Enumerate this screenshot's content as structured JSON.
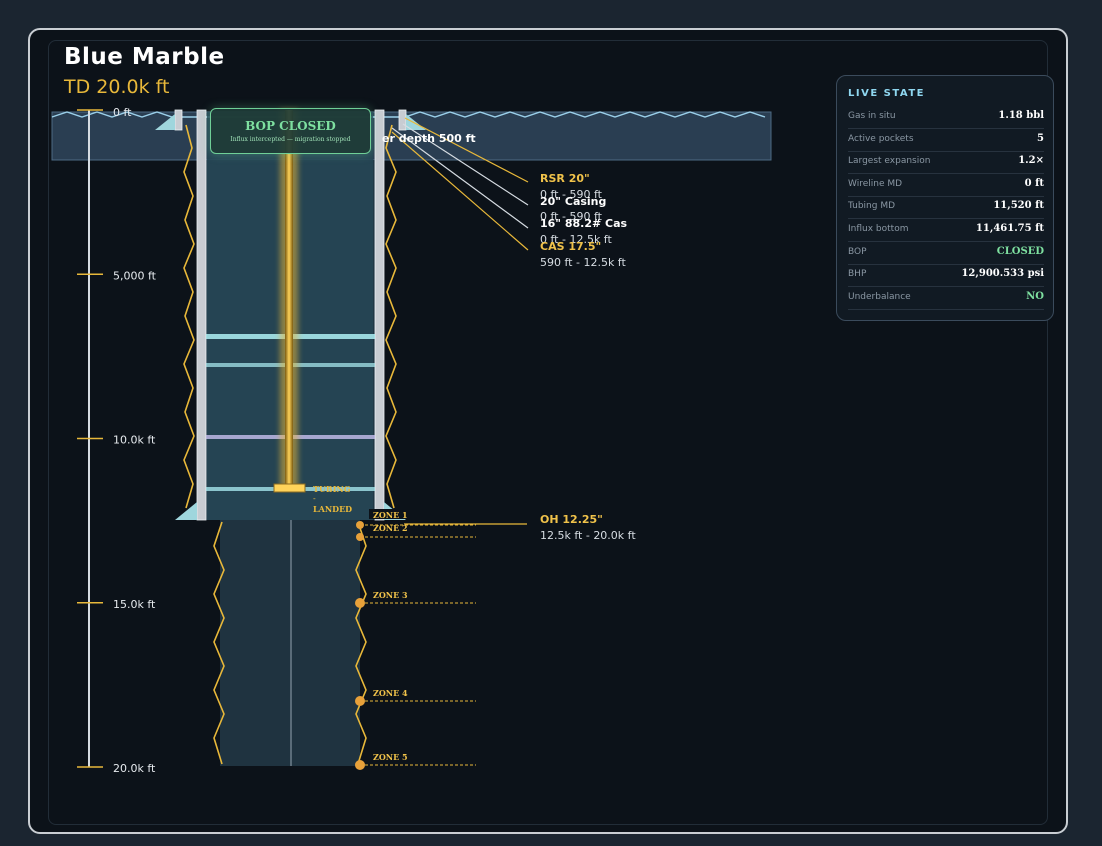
{
  "header": {
    "title": "Blue Marble",
    "subtitle": "TD 20.0k ft"
  },
  "depth_axis": {
    "ticks": [
      {
        "label": "0 ft",
        "depth_ft": 0
      },
      {
        "label": "5,000 ft",
        "depth_ft": 5000
      },
      {
        "label": "10.0k ft",
        "depth_ft": 10000
      },
      {
        "label": "15.0k ft",
        "depth_ft": 15000
      },
      {
        "label": "20.0k ft",
        "depth_ft": 20000
      }
    ]
  },
  "water": {
    "label": "er depth 500 ft"
  },
  "bop_badge": {
    "title": "BOP CLOSED",
    "message": "Influx intercepted — migration stopped"
  },
  "tubing": {
    "label_top": "TUBING",
    "label_mid": "-",
    "label_bottom": "LANDED"
  },
  "strings": [
    {
      "name": "RSR 20\"",
      "range": "0 ft - 590 ft",
      "color": "#f0c24a"
    },
    {
      "name": "20\" Casing",
      "range": "0 ft - 590 ft",
      "color": "#ffffff"
    },
    {
      "name": "16\" 88.2# Cas",
      "range": "0 ft - 12.5k ft",
      "color": "#ffffff"
    },
    {
      "name": "CAS 17.5\"",
      "range": "590 ft - 12.5k ft",
      "color": "#f0c24a"
    }
  ],
  "open_hole": {
    "name": "OH 12.25\"",
    "range": "12.5k ft - 20.0k ft"
  },
  "zones": [
    {
      "label": "ZONE 1"
    },
    {
      "label": "ZONE 2"
    },
    {
      "label": "ZONE 3"
    },
    {
      "label": "ZONE 4"
    },
    {
      "label": "ZONE 5"
    }
  ],
  "live_state": {
    "heading": "LIVE STATE",
    "rows": [
      {
        "key": "Gas in situ",
        "value": "1.18 bbl",
        "color": "#ffffff"
      },
      {
        "key": "Active pockets",
        "value": "5",
        "color": "#ffffff"
      },
      {
        "key": "Largest expansion",
        "value": "1.2×",
        "color": "#ffffff"
      },
      {
        "key": "Wireline MD",
        "value": "0 ft",
        "color": "#ffffff"
      },
      {
        "key": "Tubing MD",
        "value": "11,520 ft",
        "color": "#ffffff"
      },
      {
        "key": "Influx bottom",
        "value": "11,461.75 ft",
        "color": "#ffffff"
      },
      {
        "key": "BOP",
        "value": "CLOSED",
        "color": "#7ee0a0"
      },
      {
        "key": "BHP",
        "value": "12,900.533 psi",
        "color": "#ffffff"
      },
      {
        "key": "Underbalance",
        "value": "NO",
        "color": "#7ee0a0"
      }
    ]
  },
  "colors": {
    "accent_gold": "#e8b83a",
    "accent_green": "#7ee0a0",
    "casing_steel": "#c8ccd2",
    "water": "#2a3e52"
  }
}
